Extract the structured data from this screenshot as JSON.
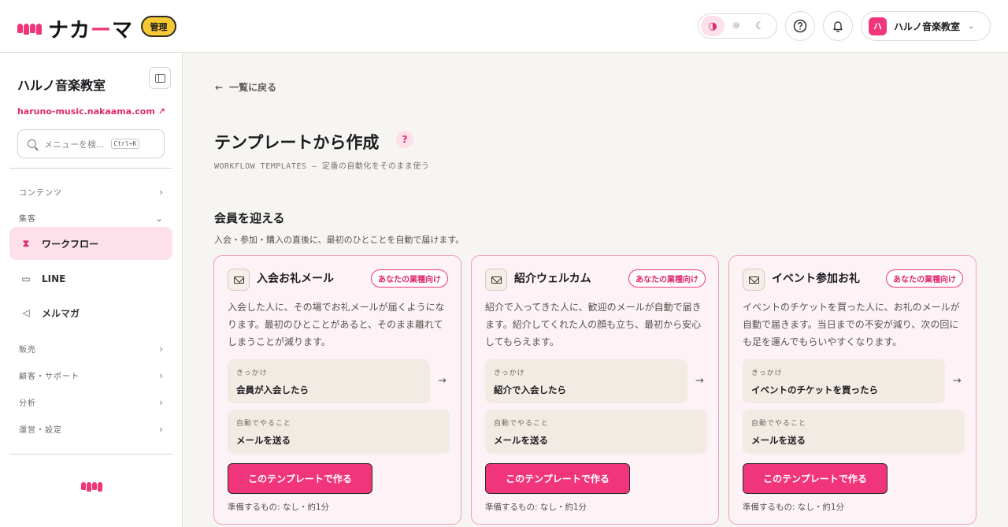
{
  "brand": {
    "name_part1": "ナカ",
    "name_part2": "ー",
    "name_part3": "マ",
    "admin_badge": "管理",
    "accent": "#f0357b"
  },
  "header": {
    "theme_options": [
      "system",
      "light",
      "dark"
    ],
    "account_initial": "ハ",
    "account_name": "ハルノ音楽教室"
  },
  "sidebar": {
    "org_name": "ハルノ音楽教室",
    "url": "haruno-music.nakaama.com",
    "search_placeholder": "メニューを検...",
    "search_shortcut": "Ctrl+K",
    "groups": {
      "contents": "コンテンツ",
      "acquisition": "集客",
      "sales": "販売",
      "customers": "顧客・サポート",
      "analytics": "分析",
      "settings": "運営・設定"
    },
    "items": {
      "workflow": "ワークフロー",
      "line": "LINE",
      "mailmag": "メルマガ"
    }
  },
  "main": {
    "back": "一覧に戻る",
    "title": "テンプレートから作成",
    "help": "?",
    "subtitle": "WORKFLOW TEMPLATES — 定番の自動化をそのまま使う",
    "section_title": "会員を迎える",
    "section_desc": "入会・参加・購入の直後に、最初のひとことを自動で届けます。",
    "cards": [
      {
        "title": "入会お礼メール",
        "tag": "あなたの業種向け",
        "desc": "入会した人に、その場でお礼メールが届くようになります。最初のひとことがあると、そのまま離れてしまうことが減ります。",
        "trigger_label": "きっかけ",
        "trigger": "会員が入会したら",
        "action_label": "自動でやること",
        "action": "メールを送る",
        "cta": "このテンプレートで作る",
        "prep": "準備するもの: なし・約1分"
      },
      {
        "title": "紹介ウェルカム",
        "tag": "あなたの業種向け",
        "desc": "紹介で入ってきた人に、歓迎のメールが自動で届きます。紹介してくれた人の顔も立ち、最初から安心してもらえます。",
        "trigger_label": "きっかけ",
        "trigger": "紹介で入会したら",
        "action_label": "自動でやること",
        "action": "メールを送る",
        "cta": "このテンプレートで作る",
        "prep": "準備するもの: なし・約1分"
      },
      {
        "title": "イベント参加お礼",
        "tag": "あなたの業種向け",
        "desc": "イベントのチケットを買った人に、お礼のメールが自動で届きます。当日までの不安が減り、次の回にも足を運んでもらいやすくなります。",
        "trigger_label": "きっかけ",
        "trigger": "イベントのチケットを買ったら",
        "action_label": "自動でやること",
        "action": "メールを送る",
        "cta": "このテンプレートで作る",
        "prep": "準備するもの: なし・約1分"
      }
    ]
  }
}
